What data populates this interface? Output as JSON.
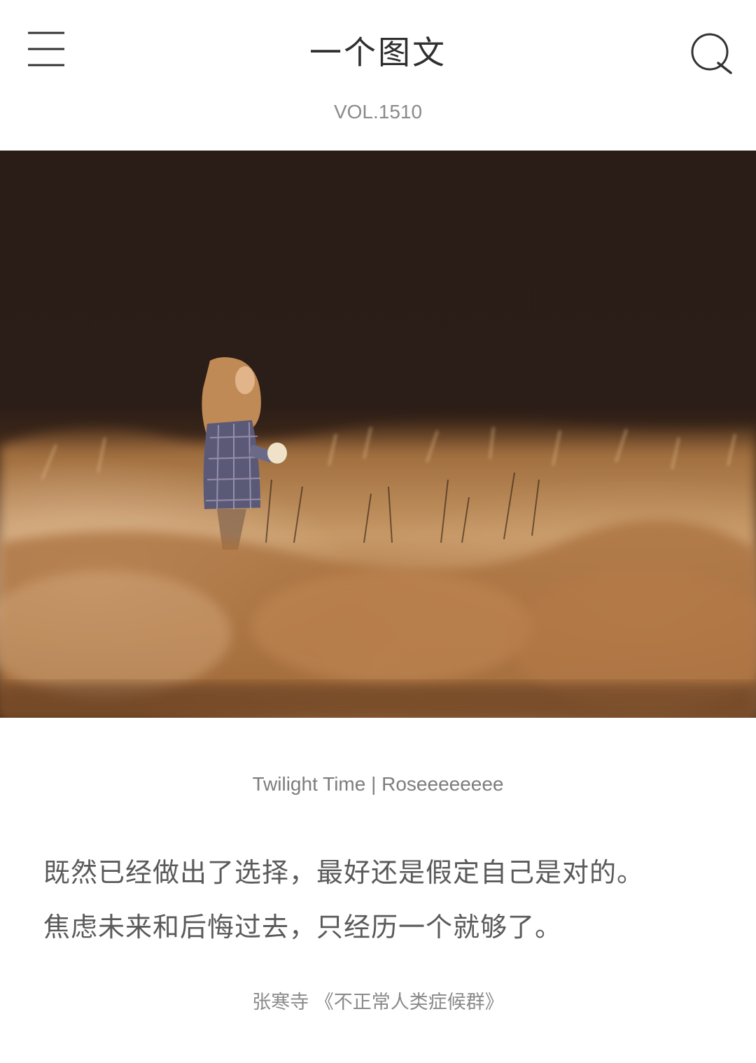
{
  "header": {
    "title": "一个图文",
    "menu_icon": "hamburger-menu-icon",
    "search_icon": "search-icon"
  },
  "volume": "VOL.1510",
  "photo": {
    "description_icon": "photo",
    "credit": "Twilight Time | Roseeeeeeee"
  },
  "quote": {
    "lines": [
      "既然已经做出了选择，最好还是假定自己是对的。",
      "焦虑未来和后悔过去，只经历一个就够了。"
    ]
  },
  "source": "张寒寺 《不正常人类症候群》",
  "colors": {
    "title": "#2f2f2f",
    "secondary_text": "#8a8a8a",
    "quote_text": "#5a5a5a",
    "background": "#ffffff"
  }
}
